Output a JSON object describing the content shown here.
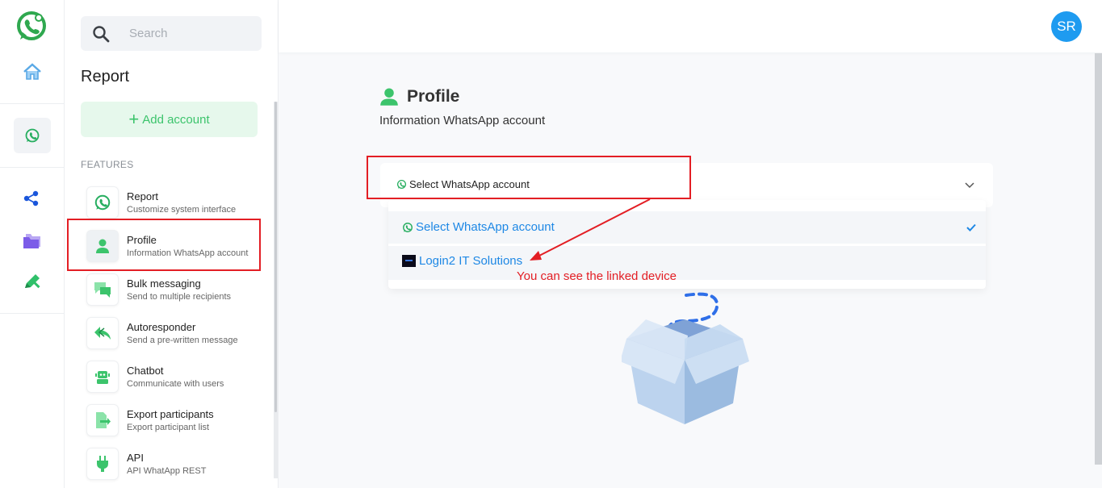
{
  "colors": {
    "brand_green": "#3cc46c",
    "accent_blue": "#1e88e5",
    "annotation_red": "#e31e24",
    "avatar_blue": "#1e9bf0"
  },
  "rail": {
    "icons": [
      "whatsapp-logo-icon",
      "home-icon",
      "whatsapp-icon",
      "share-nodes-icon",
      "folder-icon",
      "edit-pen-icon"
    ]
  },
  "sidebar": {
    "search_placeholder": "Search",
    "title": "Report",
    "add_account": "Add account",
    "features_label": "FEATURES",
    "items": [
      {
        "title": "Report",
        "subtitle": "Customize system interface",
        "icon": "whatsapp-icon"
      },
      {
        "title": "Profile",
        "subtitle": "Information WhatsApp account",
        "icon": "user-icon"
      },
      {
        "title": "Bulk messaging",
        "subtitle": "Send to multiple recipients",
        "icon": "chat-bubbles-icon"
      },
      {
        "title": "Autoresponder",
        "subtitle": "Send a pre-written message",
        "icon": "reply-icon"
      },
      {
        "title": "Chatbot",
        "subtitle": "Communicate with users",
        "icon": "robot-icon"
      },
      {
        "title": "Export participants",
        "subtitle": "Export participant list",
        "icon": "export-icon"
      },
      {
        "title": "API",
        "subtitle": "API WhatApp REST",
        "icon": "plug-icon"
      }
    ]
  },
  "header": {
    "avatar_initials": "SR"
  },
  "main": {
    "title": "Profile",
    "subtitle": "Information WhatsApp account",
    "select": {
      "label": "Select WhatsApp account",
      "options": [
        "Select WhatsApp account",
        "Login2 IT Solutions"
      ],
      "selected": "Select WhatsApp account"
    },
    "annotation": "You can see the linked device"
  }
}
